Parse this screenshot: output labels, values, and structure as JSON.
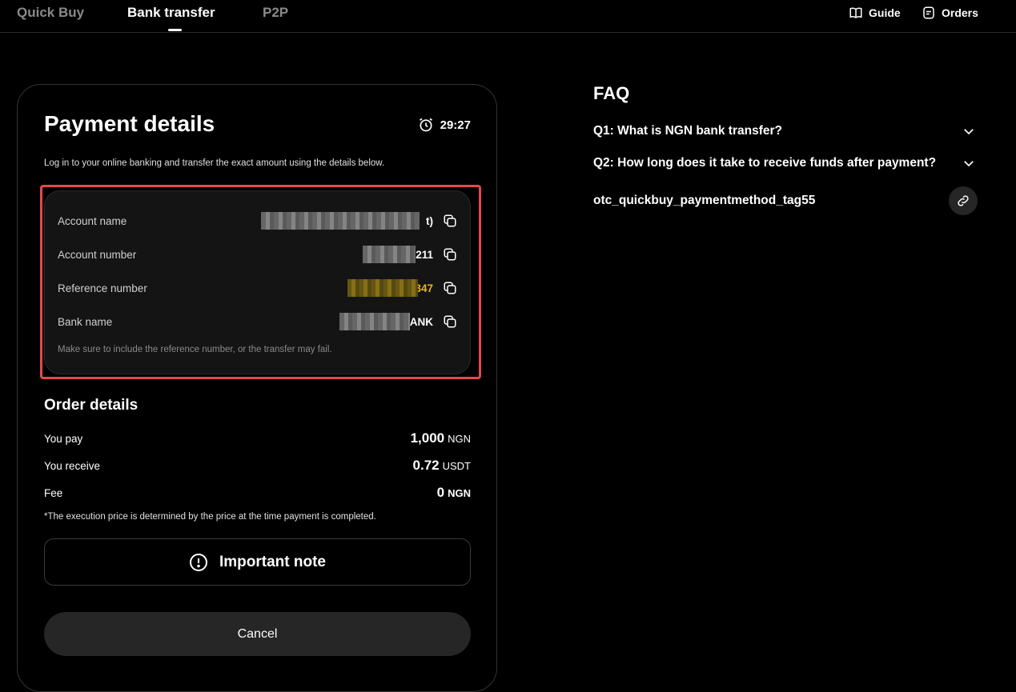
{
  "tabs": [
    {
      "label": "Quick Buy",
      "active": false
    },
    {
      "label": "Bank transfer",
      "active": true
    },
    {
      "label": "P2P",
      "active": false
    }
  ],
  "header_links": {
    "guide": "Guide",
    "orders": "Orders"
  },
  "payment": {
    "title": "Payment details",
    "timer": "29:27",
    "description": "Log in to your online banking and transfer the exact amount using the details below.",
    "rows": [
      {
        "label": "Account name",
        "value_visible": "t)"
      },
      {
        "label": "Account number",
        "value_visible": "211"
      },
      {
        "label": "Reference number",
        "value_visible": "347"
      },
      {
        "label": "Bank name",
        "value_visible": "ANK"
      }
    ],
    "note": "Make sure to include the reference number, or the transfer may fail."
  },
  "order": {
    "title": "Order details",
    "rows": [
      {
        "label": "You pay",
        "amount": "1,000",
        "currency": "NGN"
      },
      {
        "label": "You receive",
        "amount": "0.72",
        "currency": "USDT"
      },
      {
        "label": "Fee",
        "amount": "0",
        "currency": "NGN"
      }
    ],
    "price_note": "*The execution price is determined by the price at the time payment is completed."
  },
  "buttons": {
    "important": "Important note",
    "cancel": "Cancel"
  },
  "faq": {
    "title": "FAQ",
    "items": [
      "Q1: What is NGN bank transfer?",
      "Q2: How long does it take to receive funds after payment?"
    ],
    "tag": "otc_quickbuy_paymentmethod_tag55"
  },
  "colors": {
    "accent_gold": "#e8b325",
    "highlight_red": "#e5484d"
  }
}
